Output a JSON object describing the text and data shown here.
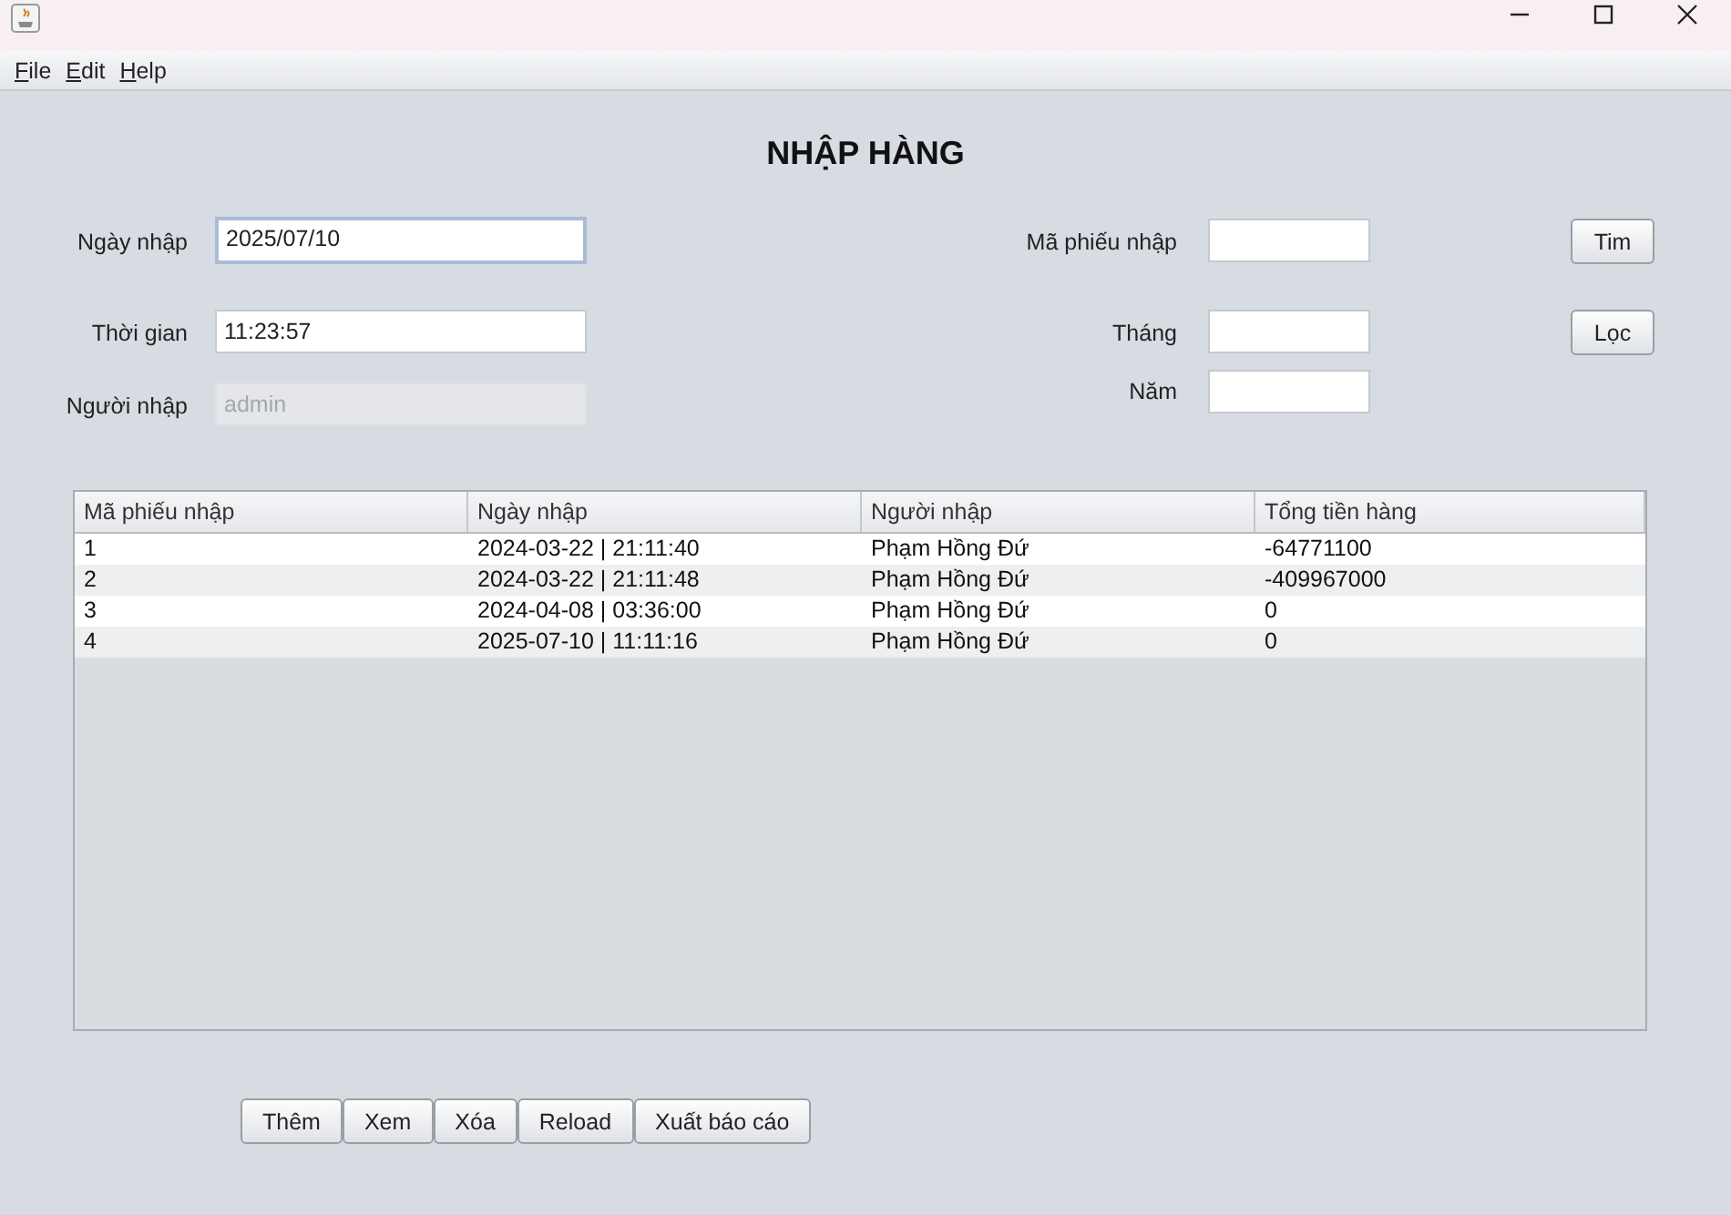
{
  "menu": [
    {
      "label": "File"
    },
    {
      "label": "Edit"
    },
    {
      "label": "Help"
    }
  ],
  "title": "NHẬP HÀNG",
  "form_left": [
    {
      "label": "Ngày nhập",
      "value": "2025/07/10",
      "focused": true,
      "disabled": false
    },
    {
      "label": "Thời gian",
      "value": "11:23:57",
      "focused": false,
      "disabled": false
    },
    {
      "label": "Người nhập",
      "value": "admin",
      "focused": false,
      "disabled": true
    }
  ],
  "form_right": [
    {
      "label": "Mã phiếu nhập",
      "button": "Tim"
    },
    {
      "label": "Tháng",
      "button": "Lọc"
    },
    {
      "label": "Năm"
    }
  ],
  "table": {
    "columns": [
      "Mã phiếu nhập",
      "Ngày nhập",
      "Người nhập",
      "Tổng tiền hàng"
    ],
    "rows": [
      [
        "1",
        "2024-03-22 | 21:11:40",
        "Phạm Hồng Đứ",
        "-64771100"
      ],
      [
        "2",
        "2024-03-22 | 21:11:48",
        "Phạm Hồng Đứ",
        "-409967000"
      ],
      [
        "3",
        "2024-04-08 | 03:36:00",
        "Phạm Hồng Đứ",
        "0"
      ],
      [
        "4",
        "2025-07-10 | 11:11:16",
        "Phạm Hồng Đứ",
        "0"
      ]
    ]
  },
  "buttons": [
    "Thêm",
    "Xem",
    "Xóa",
    "Reload",
    "Xuất báo cáo"
  ]
}
